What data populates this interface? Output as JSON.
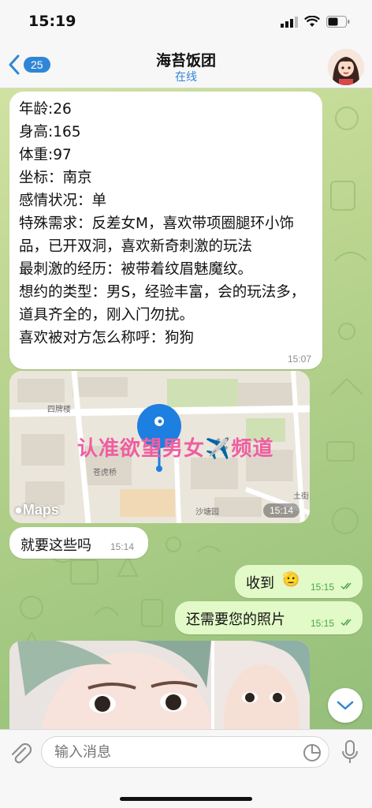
{
  "status_bar": {
    "time": "15:19"
  },
  "header": {
    "back_count": "25",
    "title": "海苔饭团",
    "status": "在线"
  },
  "messages": [
    {
      "id": "profile",
      "direction": "in",
      "lines": [
        "年龄:26",
        "身高:165",
        "体重:97",
        "坐标：南京",
        "感情状况：单",
        "特殊需求：反差女M，喜欢带项圈腿环小饰品，已开双洞，喜欢新奇刺激的玩法",
        "最刺激的经历：被带着纹眉魅魔纹。",
        "想约的类型：男S，经验丰富，会的玩法多，道具齐全的，刚入门勿扰。",
        "喜欢被对方怎么称呼：狗狗"
      ],
      "time": "15:07"
    },
    {
      "id": "map",
      "direction": "in",
      "map_labels": [
        "四牌楼",
        "沙塘园",
        "土街",
        "苍虎桥"
      ],
      "maps_brand": "Maps",
      "overlay_text": "认准欲望男女✈️频道",
      "time": "15:14"
    },
    {
      "id": "reply1",
      "direction": "in",
      "text": "就要这些吗",
      "time": "15:14"
    },
    {
      "id": "out1",
      "direction": "out",
      "text": "收到",
      "emoji": "🫡",
      "time": "15:15"
    },
    {
      "id": "out2",
      "direction": "out",
      "text": "还需要您的照片",
      "time": "15:15"
    }
  ],
  "input": {
    "placeholder": "输入消息"
  },
  "colors": {
    "accent": "#2f86d6",
    "incoming_bubble": "#ffffff",
    "outgoing_bubble": "#e2f9c8",
    "read_check": "#4aa84a",
    "overlay_pink": "#ee5fa0"
  },
  "icons": {
    "back": "chevron-left-icon",
    "attach": "paperclip-icon",
    "sticker": "sticker-icon",
    "mic": "microphone-icon",
    "scroll_down": "chevron-down-icon",
    "read": "double-check-icon"
  }
}
